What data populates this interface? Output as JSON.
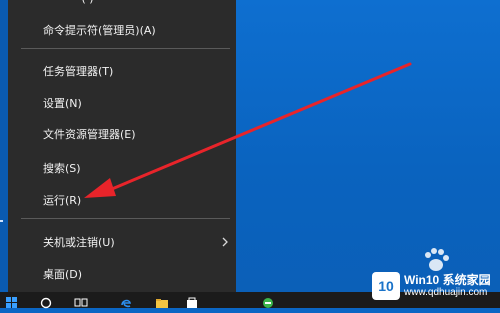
{
  "menu": {
    "items": [
      {
        "label": "命令提示符(管理员)(A)"
      },
      {
        "label": "任务管理器(T)"
      },
      {
        "label": "设置(N)"
      },
      {
        "label": "文件资源管理器(E)"
      },
      {
        "label": "搜索(S)"
      },
      {
        "label": "运行(R)"
      },
      {
        "label": "关机或注销(U)"
      },
      {
        "label": "桌面(D)"
      }
    ]
  },
  "watermark": {
    "badge": "10",
    "title": "Win10 系统家园",
    "url": "www.qdhuajin.com"
  },
  "colors": {
    "menu_bg": "#2b2b2b",
    "desktop_bg": "#0b66c4",
    "arrow": "#e8242a"
  }
}
